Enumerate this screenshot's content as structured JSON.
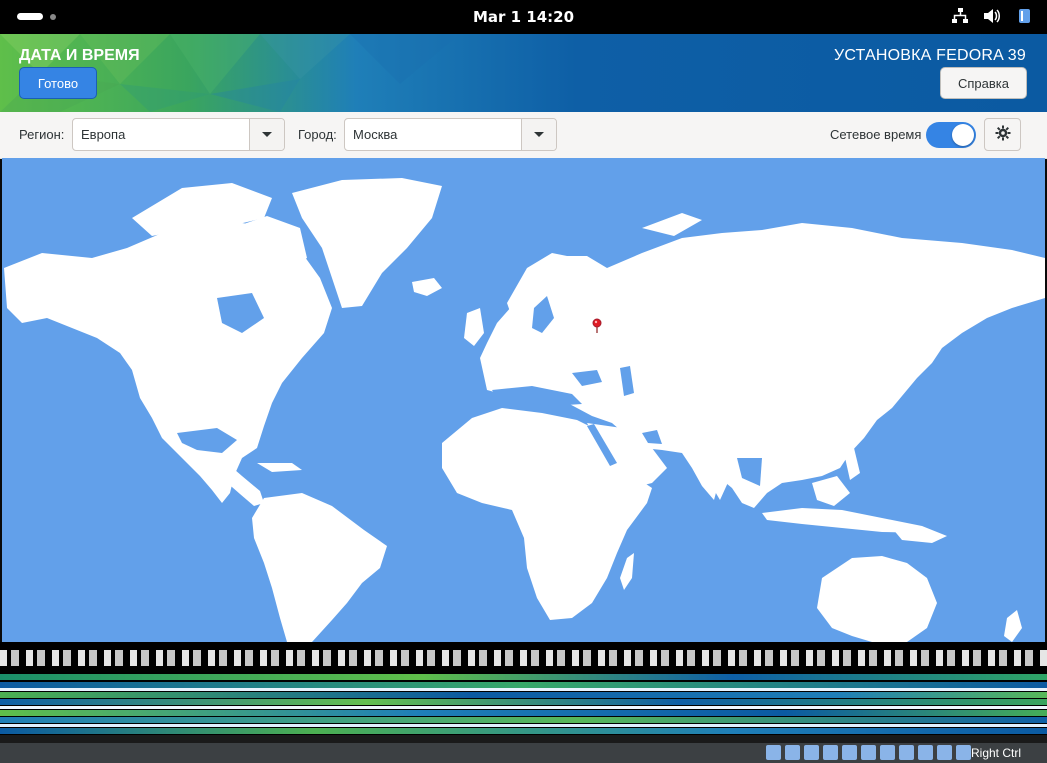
{
  "topbar": {
    "clock": "Mar 1  14:20",
    "icons": [
      "activities-indicator",
      "network-icon",
      "volume-icon",
      "accessibility-icon"
    ]
  },
  "header": {
    "spoke_title": "ДАТА И ВРЕМЯ",
    "done_label": "Готово",
    "product_title": "УСТАНОВКА FEDORA 39",
    "help_label": "Справка"
  },
  "toolbar": {
    "region_label": "Регион:",
    "region_value": "Европа",
    "city_label": "Город:",
    "city_value": "Москва",
    "network_time_label": "Сетевое время",
    "network_time_on": true
  },
  "map": {
    "ocean_color": "#62a0ea",
    "land_color": "#ffffff",
    "pin_color": "#e01b24",
    "selected_city": "Москва"
  },
  "statusbar": {
    "host_key": "Right Ctrl"
  },
  "colors": {
    "accent": "#3584e4",
    "topbar": "#000000"
  }
}
